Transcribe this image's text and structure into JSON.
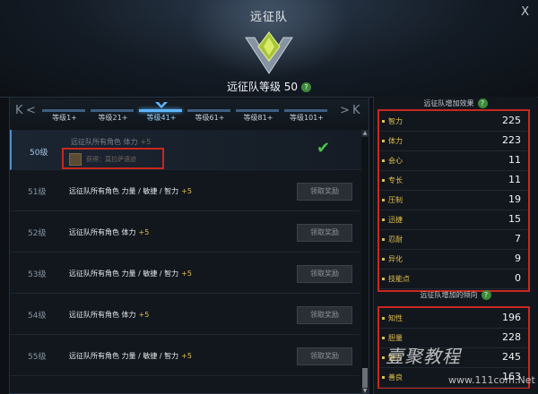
{
  "window": {
    "title": "远征队",
    "close_label": "X"
  },
  "team_level": {
    "label": "远征队等级 50",
    "help": "?"
  },
  "tabs": {
    "first_label": "K",
    "prev_label": "<",
    "next_label": ">",
    "last_label": "K",
    "items": [
      "等级1+",
      "等级21+",
      "等级41+",
      "等级61+",
      "等级81+",
      "等级101+"
    ],
    "active_index": 2
  },
  "rows": [
    {
      "level": "50级",
      "text": "远征队所有角色 体力",
      "bonus": "+5",
      "reward_text": "获得：莫拉萨语迹",
      "completed": true
    },
    {
      "level": "51级",
      "text": "远征队所有角色 力量 / 敏捷 / 智力",
      "bonus": "+5",
      "button": "领取奖励"
    },
    {
      "level": "52级",
      "text": "远征队所有角色 体力",
      "bonus": "+5",
      "button": "领取奖励"
    },
    {
      "level": "53级",
      "text": "远征队所有角色 力量 / 敏捷 / 智力",
      "bonus": "+5",
      "button": "领取奖励"
    },
    {
      "level": "54级",
      "text": "远征队所有角色 体力",
      "bonus": "+5",
      "button": "领取奖励"
    },
    {
      "level": "55级",
      "text": "远征队所有角色 力量 / 敏捷 / 智力",
      "bonus": "+5",
      "button": "领取奖励"
    }
  ],
  "effects": {
    "title": "远征队增加效果",
    "help": "?",
    "stats": [
      {
        "name": "智力",
        "value": "225"
      },
      {
        "name": "体力",
        "value": "223"
      },
      {
        "name": "会心",
        "value": "11"
      },
      {
        "name": "专长",
        "value": "11"
      },
      {
        "name": "压制",
        "value": "19"
      },
      {
        "name": "迅捷",
        "value": "15"
      },
      {
        "name": "忍耐",
        "value": "7"
      },
      {
        "name": "异化",
        "value": "9"
      },
      {
        "name": "技能点",
        "value": "0"
      }
    ]
  },
  "tendency": {
    "title": "远征队增加的倾向",
    "help": "?",
    "stats": [
      {
        "name": "知性",
        "value": "196"
      },
      {
        "name": "胆量",
        "value": "228"
      },
      {
        "name": "魅力",
        "value": "245"
      },
      {
        "name": "善良",
        "value": "163"
      }
    ]
  },
  "watermark": {
    "text": "壹聚教程",
    "url": "www.111com.Net"
  },
  "colors": {
    "accent": "#5fb7ff",
    "stat_gold": "#e1c04d",
    "highlight_red": "#c8281f",
    "check_green": "#48c04a"
  }
}
